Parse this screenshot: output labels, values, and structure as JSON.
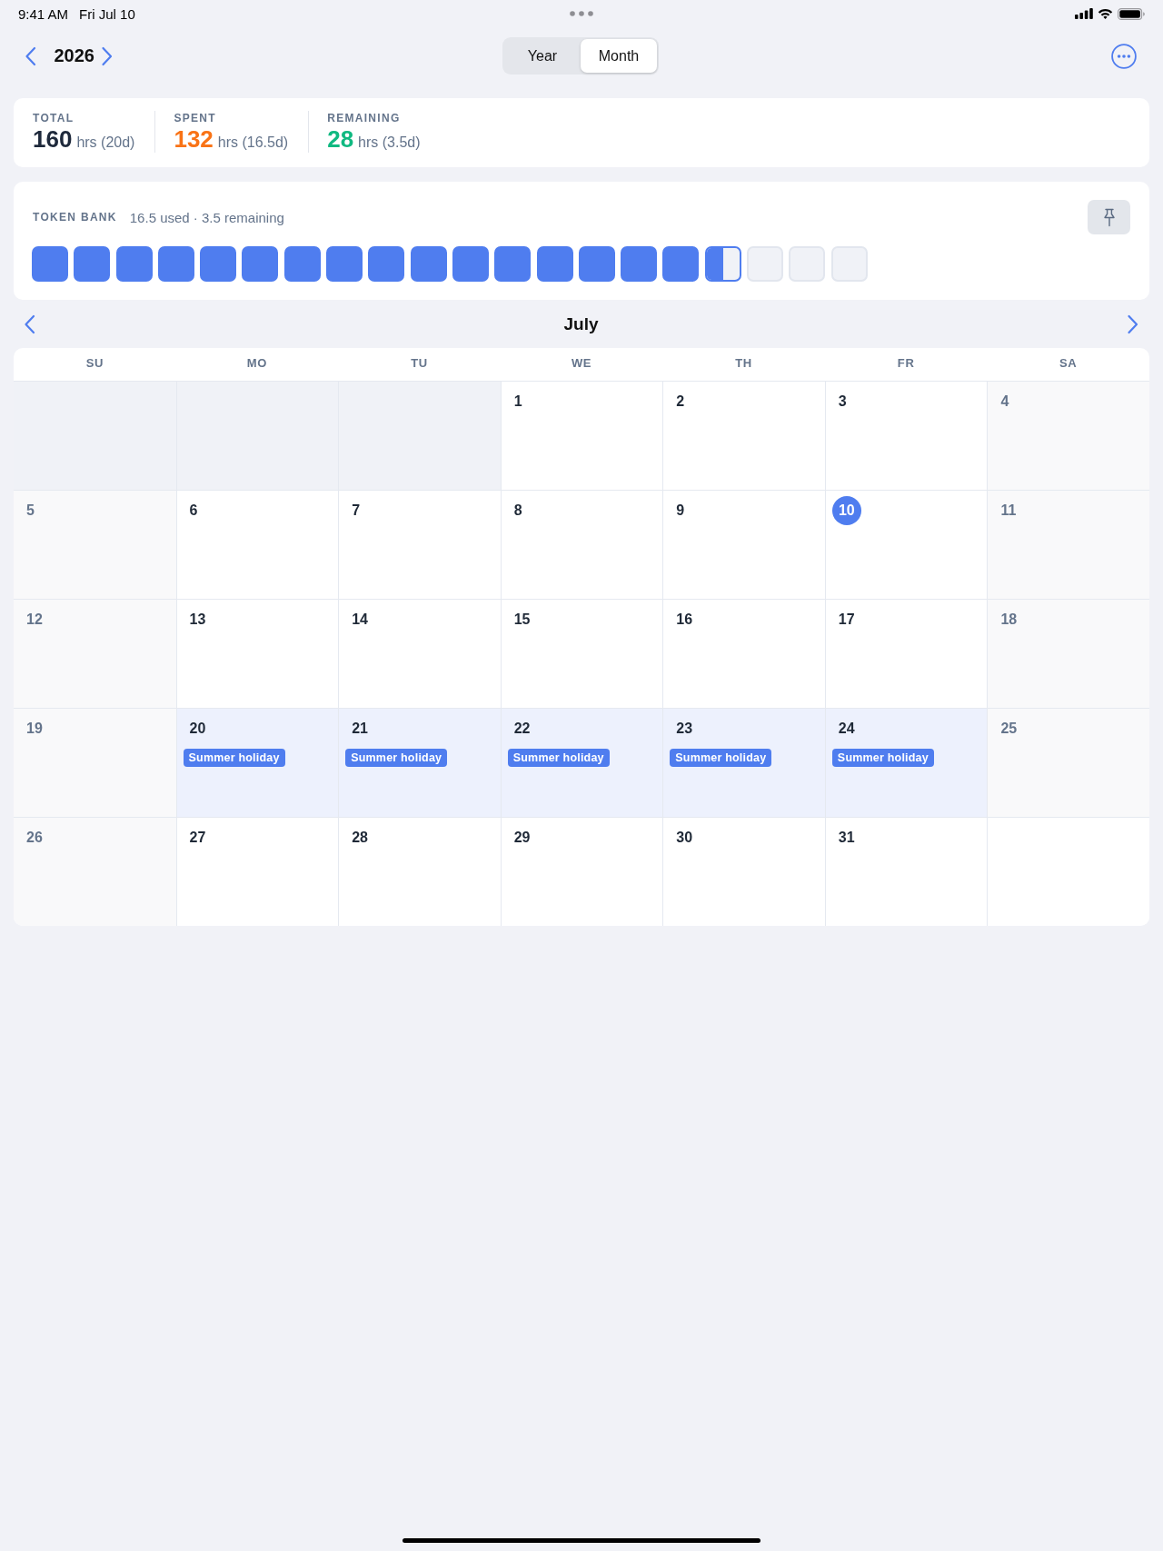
{
  "status_bar": {
    "time": "9:41 AM",
    "date": "Fri Jul 10"
  },
  "toolbar": {
    "year": "2026",
    "view_tabs": [
      {
        "label": "Year",
        "selected": false
      },
      {
        "label": "Month",
        "selected": true
      }
    ]
  },
  "summary": [
    {
      "label": "TOTAL",
      "value": "160",
      "unit": "hrs (20d)",
      "color": "#1e293b"
    },
    {
      "label": "SPENT",
      "value": "132",
      "unit": "hrs (16.5d)",
      "color": "#f97316"
    },
    {
      "label": "REMAINING",
      "value": "28",
      "unit": "hrs (3.5d)",
      "color": "#10b981"
    }
  ],
  "token_bank": {
    "title": "TOKEN BANK",
    "caption": "16.5 used · 3.5 remaining",
    "tokens": [
      {
        "kind": "full"
      },
      {
        "kind": "full"
      },
      {
        "kind": "full"
      },
      {
        "kind": "full"
      },
      {
        "kind": "full"
      },
      {
        "kind": "full"
      },
      {
        "kind": "full"
      },
      {
        "kind": "full"
      },
      {
        "kind": "full"
      },
      {
        "kind": "full"
      },
      {
        "kind": "full"
      },
      {
        "kind": "full"
      },
      {
        "kind": "full"
      },
      {
        "kind": "full"
      },
      {
        "kind": "full"
      },
      {
        "kind": "full"
      },
      {
        "kind": "half"
      },
      {
        "kind": "empty"
      },
      {
        "kind": "empty"
      },
      {
        "kind": "empty"
      }
    ]
  },
  "calendar": {
    "month": "July",
    "weekdays": [
      "SU",
      "MO",
      "TU",
      "WE",
      "TH",
      "FR",
      "SA"
    ],
    "weeks": [
      [
        {
          "kind": "blank"
        },
        {
          "kind": "blank"
        },
        {
          "kind": "blank"
        },
        {
          "kind": "day",
          "day": "1",
          "weekend": false,
          "today": false
        },
        {
          "kind": "day",
          "day": "2",
          "weekend": false,
          "today": false
        },
        {
          "kind": "day",
          "day": "3",
          "weekend": false,
          "today": false
        },
        {
          "kind": "day",
          "day": "4",
          "weekend": true,
          "today": false
        }
      ],
      [
        {
          "kind": "day",
          "day": "5",
          "weekend": true,
          "today": false
        },
        {
          "kind": "day",
          "day": "6",
          "weekend": false,
          "today": false
        },
        {
          "kind": "day",
          "day": "7",
          "weekend": false,
          "today": false
        },
        {
          "kind": "day",
          "day": "8",
          "weekend": false,
          "today": false
        },
        {
          "kind": "day",
          "day": "9",
          "weekend": false,
          "today": false
        },
        {
          "kind": "day",
          "day": "10",
          "weekend": false,
          "today": true
        },
        {
          "kind": "day",
          "day": "11",
          "weekend": true,
          "today": false
        }
      ],
      [
        {
          "kind": "day",
          "day": "12",
          "weekend": true,
          "today": false
        },
        {
          "kind": "day",
          "day": "13",
          "weekend": false,
          "today": false
        },
        {
          "kind": "day",
          "day": "14",
          "weekend": false,
          "today": false
        },
        {
          "kind": "day",
          "day": "15",
          "weekend": false,
          "today": false
        },
        {
          "kind": "day",
          "day": "16",
          "weekend": false,
          "today": false
        },
        {
          "kind": "day",
          "day": "17",
          "weekend": false,
          "today": false
        },
        {
          "kind": "day",
          "day": "18",
          "weekend": true,
          "today": false
        }
      ],
      [
        {
          "kind": "day",
          "day": "19",
          "weekend": true,
          "today": false
        },
        {
          "kind": "day",
          "day": "20",
          "weekend": false,
          "today": false,
          "events": [
            {
              "label": "Summer holiday"
            }
          ]
        },
        {
          "kind": "day",
          "day": "21",
          "weekend": false,
          "today": false,
          "events": [
            {
              "label": "Summer holiday"
            }
          ]
        },
        {
          "kind": "day",
          "day": "22",
          "weekend": false,
          "today": false,
          "events": [
            {
              "label": "Summer holiday"
            }
          ]
        },
        {
          "kind": "day",
          "day": "23",
          "weekend": false,
          "today": false,
          "events": [
            {
              "label": "Summer holiday"
            }
          ]
        },
        {
          "kind": "day",
          "day": "24",
          "weekend": false,
          "today": false,
          "events": [
            {
              "label": "Summer holiday"
            }
          ]
        },
        {
          "kind": "day",
          "day": "25",
          "weekend": true,
          "today": false
        }
      ],
      [
        {
          "kind": "day",
          "day": "26",
          "weekend": true,
          "today": false
        },
        {
          "kind": "day",
          "day": "27",
          "weekend": false,
          "today": false
        },
        {
          "kind": "day",
          "day": "28",
          "weekend": false,
          "today": false
        },
        {
          "kind": "day",
          "day": "29",
          "weekend": false,
          "today": false
        },
        {
          "kind": "day",
          "day": "30",
          "weekend": false,
          "today": false
        },
        {
          "kind": "day",
          "day": "31",
          "weekend": false,
          "today": false
        },
        {
          "kind": "filler"
        }
      ]
    ]
  }
}
